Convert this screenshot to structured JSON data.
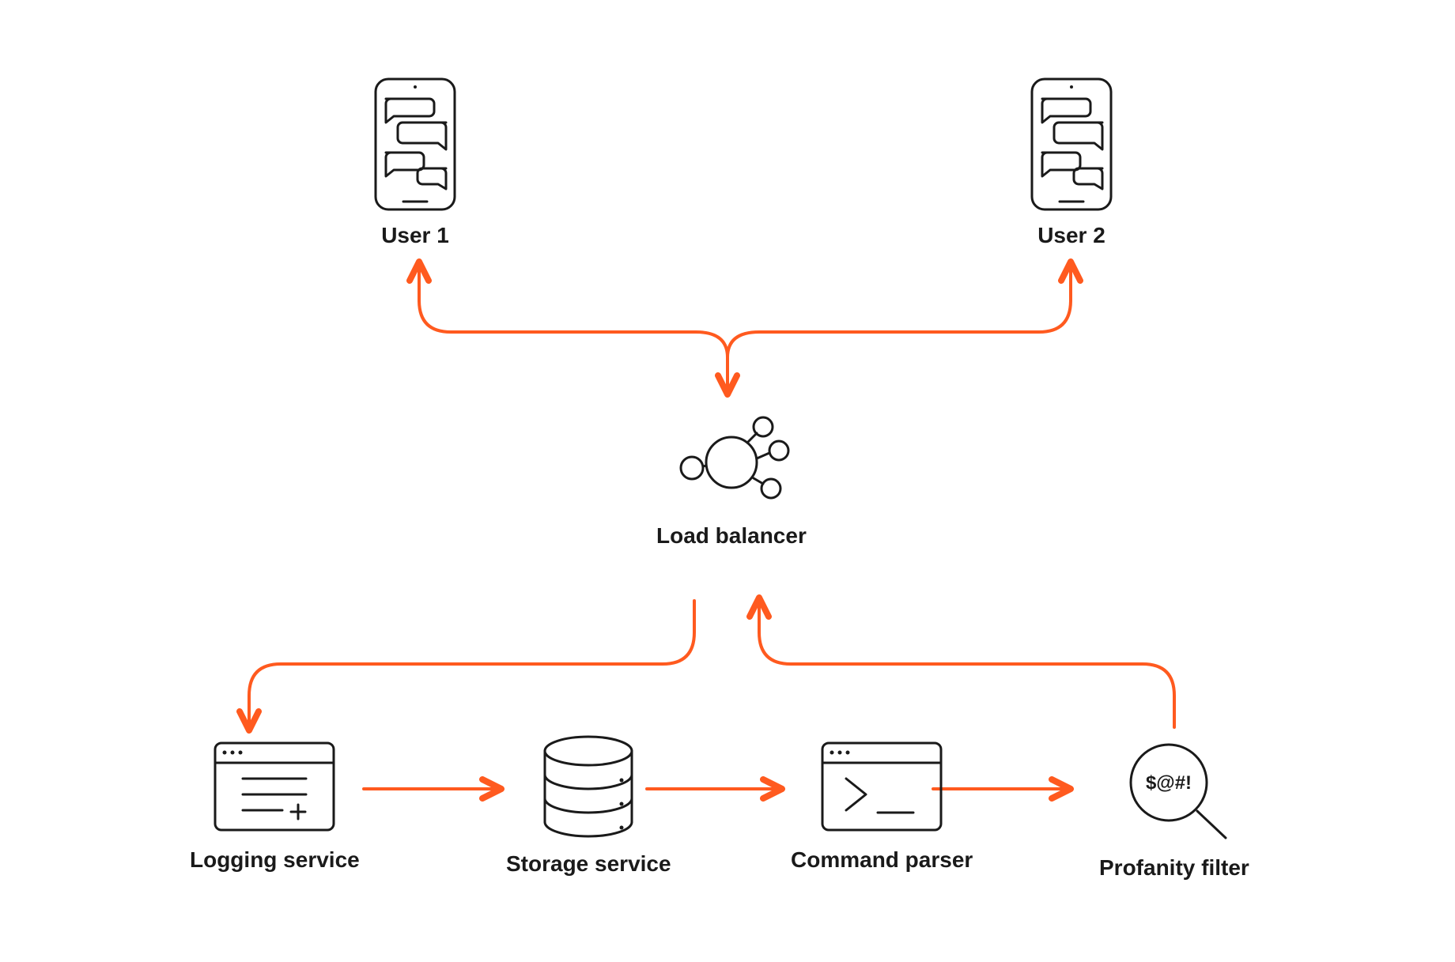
{
  "diagram": {
    "user1": {
      "label": "User 1"
    },
    "user2": {
      "label": "User 2"
    },
    "loadBalancer": {
      "label": "Load balancer"
    },
    "loggingService": {
      "label": "Logging service"
    },
    "storageService": {
      "label": "Storage service"
    },
    "commandParser": {
      "label": "Command parser"
    },
    "profanityFilter": {
      "label": "Profanity filter",
      "glyph": "$@#!"
    }
  },
  "colors": {
    "arrow": "#ff5a1f",
    "stroke": "#1a1a1a"
  }
}
